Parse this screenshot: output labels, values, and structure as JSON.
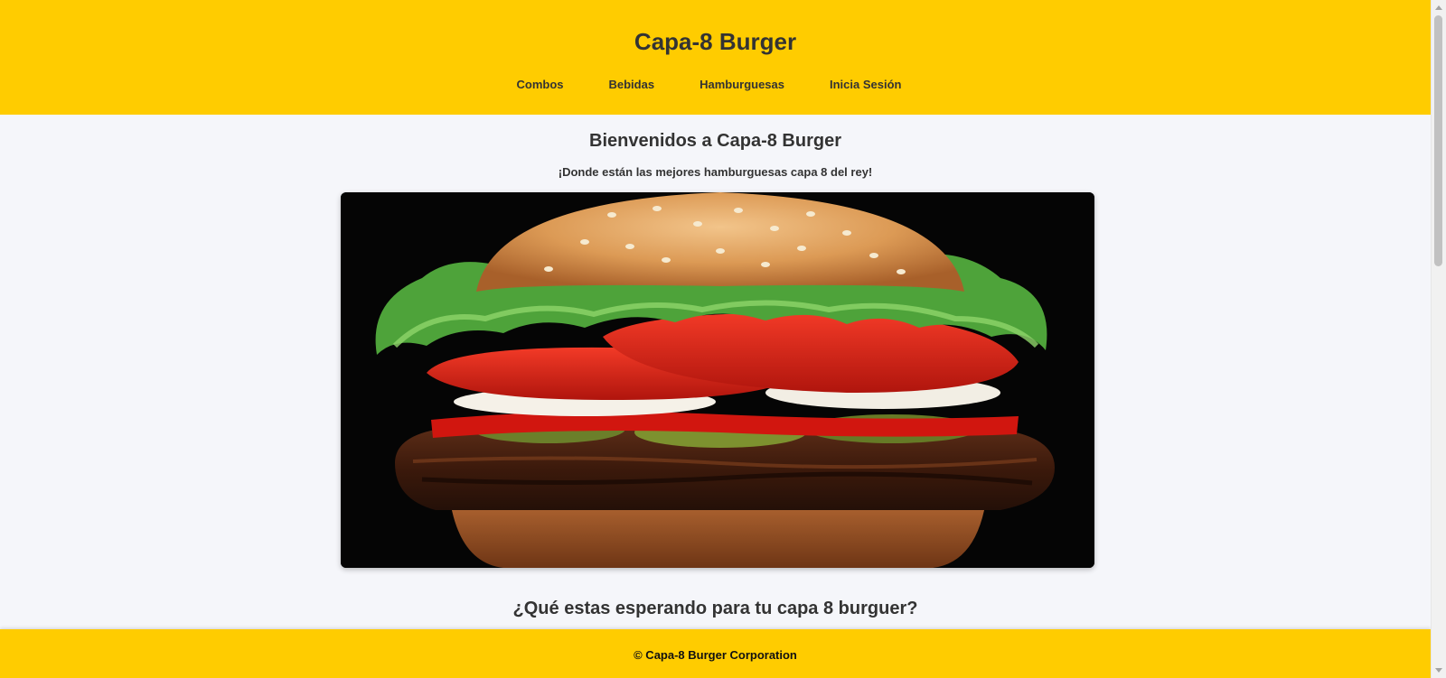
{
  "header": {
    "title": "Capa-8 Burger",
    "nav": [
      {
        "label": "Combos"
      },
      {
        "label": "Bebidas"
      },
      {
        "label": "Hamburguesas"
      },
      {
        "label": "Inicia Sesión"
      }
    ]
  },
  "main": {
    "welcome_title": "Bienvenidos a Capa-8 Burger",
    "welcome_subtitle": "¡Donde están las mejores hamburguesas capa 8 del rey!",
    "hero_image_icon": "burger-photo",
    "cta_title": "¿Qué estas esperando para tu capa 8 burguer?"
  },
  "footer": {
    "text": "© Capa-8 Burger Corporation"
  },
  "colors": {
    "brand_yellow": "#ffcc00",
    "page_background": "#f5f6fa",
    "text": "#333333"
  }
}
